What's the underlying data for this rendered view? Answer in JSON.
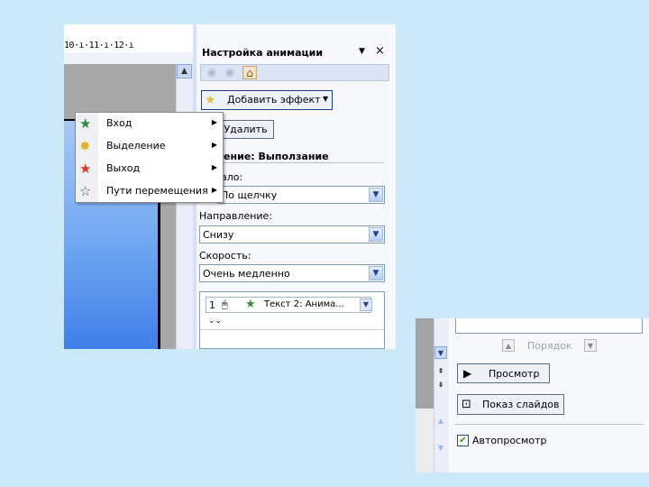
{
  "window": {
    "ruler_text": "10·ı·11·ı·12·ı",
    "pane_title": "Настройка анимации",
    "pane_menu_glyph": "▼",
    "pane_close_glyph": "×"
  },
  "toolbar": {
    "add_effect_label": "Добавить эффект",
    "add_effect_arrow": "▼",
    "remove_label": "Удалить"
  },
  "effect": {
    "change_label": "енение: Выползание",
    "start_label": "ало:",
    "start_value": "По щелчку",
    "direction_label": "Направление:",
    "direction_value": "Снизу",
    "speed_label": "Скорость:",
    "speed_value": "Очень медленно"
  },
  "effect_list": {
    "items": [
      {
        "number": "1",
        "text": "Текст 2: Анима..."
      }
    ],
    "expand_glyph": "¥"
  },
  "menu": {
    "items": [
      {
        "label": "Вход",
        "icon": "entrance-star-icon",
        "color": "#2e8b3a"
      },
      {
        "label": "Выделение",
        "icon": "emphasis-star-icon",
        "color": "#e0b020"
      },
      {
        "label": "Выход",
        "icon": "exit-star-icon",
        "color": "#d83a2a"
      },
      {
        "label": "Пути перемещения",
        "icon": "motion-path-star-icon",
        "color": "#ffffff"
      }
    ]
  },
  "bottom_panel": {
    "order_label": "Порядок",
    "play_label": "Просмотр",
    "slideshow_label": "Показ слайдов",
    "autopreview_label": "Автопросмотр",
    "autopreview_checked": true
  },
  "colors": {
    "page_background": "#cce9f9",
    "accent": "#1b3c8e",
    "slide_blue": "#6fa6f1"
  }
}
